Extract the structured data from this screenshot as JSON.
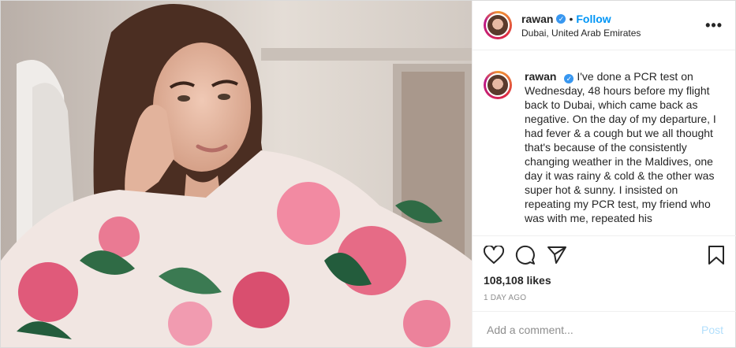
{
  "header": {
    "username": "rawan",
    "follow_label": "Follow",
    "separator": "•",
    "location": "Dubai, United Arab Emirates",
    "more_label": "•••"
  },
  "caption": {
    "username": "rawan",
    "text": "I've done a PCR test on Wednesday, 48 hours before my flight back to Dubai, which came back as negative. On the day of my departure, I had fever & a cough but we all thought that's because of the consistently changing weather in the Maldives, one day it was rainy & cold & the other was super hot & sunny. I insisted on repeating my PCR test, my friend who was with me, repeated his"
  },
  "actions": {
    "icons": [
      "heart-icon",
      "comment-icon",
      "share-icon",
      "bookmark-icon"
    ],
    "likes": "108,108 likes",
    "time_ago": "1 DAY AGO"
  },
  "comment_box": {
    "placeholder": "Add a comment...",
    "post_label": "Post"
  },
  "colors": {
    "accent": "#0095f6",
    "verified": "#3897f0",
    "post_disabled": "#b2dffc",
    "muted": "#8e8e8e"
  }
}
